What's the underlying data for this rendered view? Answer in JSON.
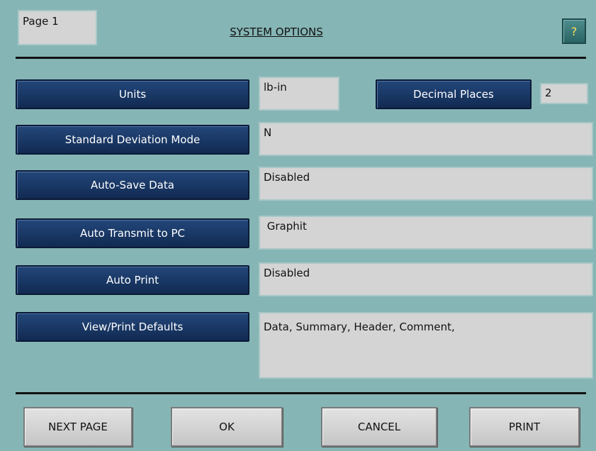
{
  "header": {
    "page_label": "Page 1",
    "title": "SYSTEM OPTIONS",
    "help_label": "?"
  },
  "options": {
    "units": {
      "label": "Units",
      "value": "lb-in"
    },
    "decimal_places": {
      "label": "Decimal Places",
      "value": "2"
    },
    "std_dev_mode": {
      "label": "Standard Deviation Mode",
      "value": "N"
    },
    "auto_save": {
      "label": "Auto-Save Data",
      "value": "Disabled"
    },
    "auto_transmit": {
      "label": "Auto Transmit to PC",
      "value": " Graphit"
    },
    "auto_print": {
      "label": "Auto Print",
      "value": "Disabled"
    },
    "view_print_defaults": {
      "label": "View/Print Defaults",
      "value": "Data, Summary, Header, Comment,"
    }
  },
  "footer": {
    "next_page": "NEXT PAGE",
    "ok": "OK",
    "cancel": "CANCEL",
    "print": "PRINT"
  },
  "colors": {
    "background": "#86b5b5",
    "option_button": "#1a3766",
    "field": "#d4d4d4",
    "help_text": "#ffe15a"
  }
}
